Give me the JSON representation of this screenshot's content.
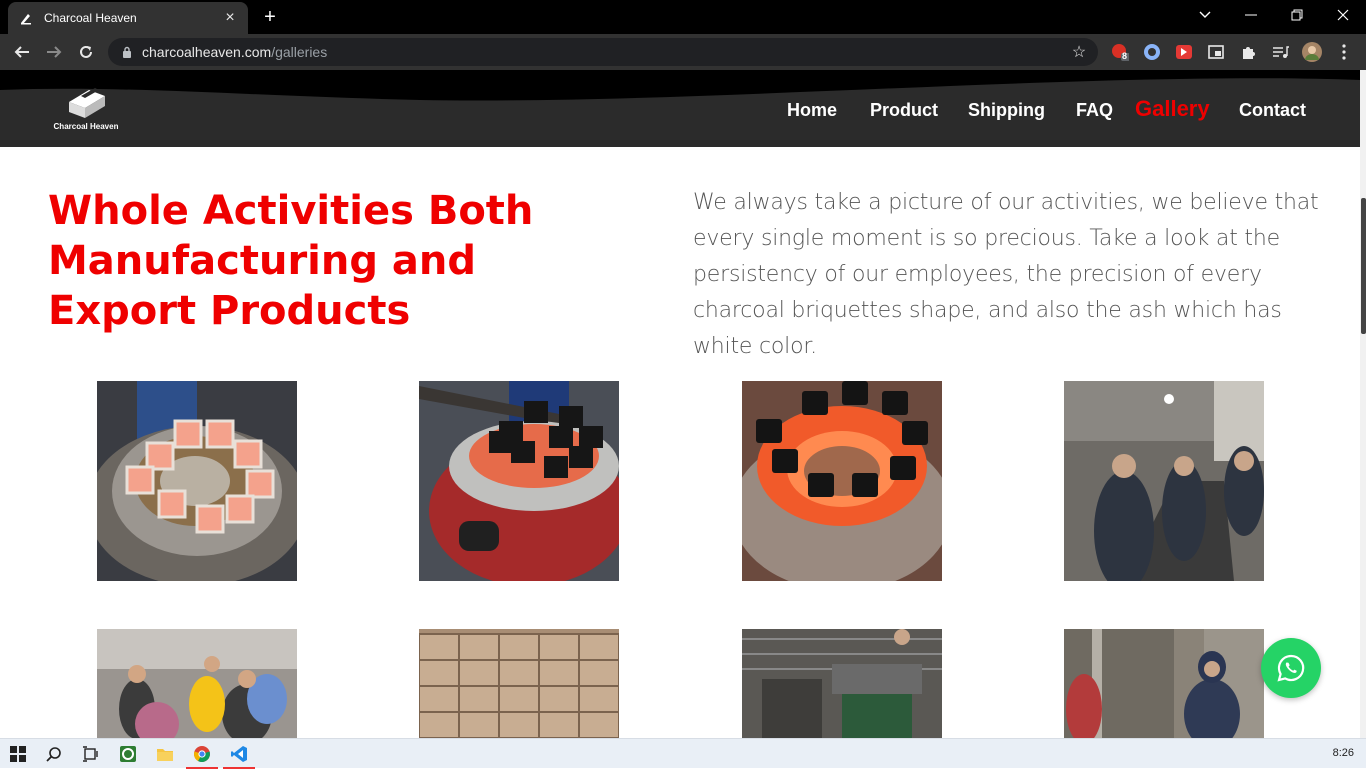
{
  "browser": {
    "tab_title": "Charcoal Heaven",
    "url_domain": "charcoalheaven.com",
    "url_path": "/galleries",
    "extension_badge": "8"
  },
  "site": {
    "logo_text": "Charcoal Heaven",
    "nav": [
      {
        "label": "Home"
      },
      {
        "label": "Product"
      },
      {
        "label": "Shipping"
      },
      {
        "label": "FAQ"
      },
      {
        "label": "Gallery",
        "active": true
      },
      {
        "label": "Contact"
      }
    ],
    "heading": "Whole Activities Both Manufacturing and Export Products",
    "intro": "We always take a picture of our activities, we believe that every single moment is so precious. Take a look at the persistency of our employees, the precision of every charcoal briquettes shape, and also the ash which has white color."
  },
  "gallery": [
    {
      "name": "burning-briquettes-white-ash"
    },
    {
      "name": "briquettes-on-burner-tongs"
    },
    {
      "name": "glowing-briquettes-ring"
    },
    {
      "name": "factory-workers-conveyor"
    },
    {
      "name": "workers-group"
    },
    {
      "name": "stacked-cartons"
    },
    {
      "name": "machinery-shed"
    },
    {
      "name": "worker-in-hijab"
    }
  ],
  "taskbar": {
    "time": "8:26"
  },
  "colors": {
    "accent": "#ef0000",
    "header_bg": "#2b2b2b",
    "whatsapp": "#25d366"
  }
}
